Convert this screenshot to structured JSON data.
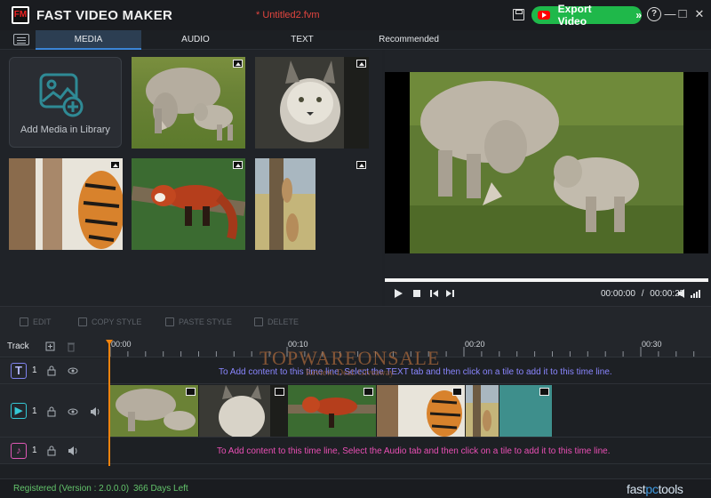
{
  "app": {
    "title": "FAST VIDEO MAKER",
    "file_name": "* Untitled2.fvm",
    "export_label": "Export Video",
    "export_chevron": "»",
    "logo_text": "FM",
    "help_symbol": "?",
    "minimize_symbol": "—",
    "maximize_symbol": "□",
    "close_symbol": "✕"
  },
  "tabs": [
    {
      "label": "MEDIA",
      "active": true
    },
    {
      "label": "AUDIO",
      "active": false
    },
    {
      "label": "TEXT",
      "active": false
    },
    {
      "label": "Recommended",
      "active": false
    }
  ],
  "media": {
    "add_label": "Add Media in Library",
    "thumbnails": [
      "rhino",
      "lynx",
      "tiger",
      "red-panda",
      "meerkats"
    ]
  },
  "player": {
    "current_time": "00:00:00",
    "separator": "/",
    "total_time": "00:00:25"
  },
  "edit_toolbar": {
    "edit": "EDIT",
    "copy_style": "COPY STYLE",
    "paste_style": "PASTE STYLE",
    "delete": "DELETE"
  },
  "timeline": {
    "track_label": "Track",
    "ruler_labels": [
      "00:00",
      "00:10",
      "00:20",
      "00:30"
    ],
    "text_track": {
      "number": "1",
      "hint": "To Add content to this time line, Select the TEXT tab and then click on a tile to add it to this time line."
    },
    "video_track": {
      "number": "1",
      "clips": [
        "rhino",
        "lynx",
        "red-panda",
        "tiger",
        "meerkats",
        "transition"
      ]
    },
    "audio_track": {
      "number": "1",
      "hint": "To Add content to this time line, Select the Audio tab and then click on a tile to add it to this time line."
    }
  },
  "watermark": {
    "line1": "TOPWAREONSALE",
    "line2": "Review. Deal. Giveaway"
  },
  "status": {
    "registration": "Registered (Version : 2.0.0.0)",
    "days_left": "366 Days Left",
    "brand_prefix": "fast",
    "brand_mid": "pc",
    "brand_suffix": "tools"
  },
  "colors": {
    "accent": "#3b85d6",
    "export_green": "#1fb84a",
    "file_name_red": "#e2453f",
    "playhead": "#f0830e",
    "text_hint": "#8a86ff",
    "audio_hint": "#ea4fb5",
    "status_green": "#63c46b"
  }
}
